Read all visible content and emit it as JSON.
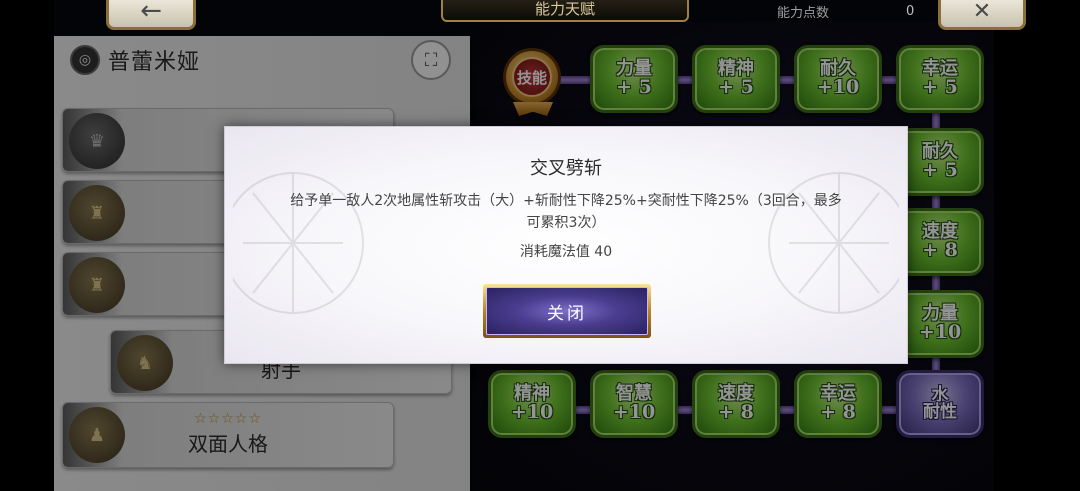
{
  "top_bar": {
    "title": "能力天赋",
    "points_label": "能力点数",
    "points_value": "0",
    "back_icon": "←",
    "close_icon": "✕"
  },
  "character": {
    "name": "普蕾米娅",
    "emblem": "◎",
    "tree_icon": "⛶",
    "cards": [
      {
        "stars": "",
        "label": "",
        "portrait": "♛"
      },
      {
        "stars": "",
        "label": "",
        "portrait": "♜"
      },
      {
        "stars": "",
        "label": "",
        "portrait": "♜"
      },
      {
        "stars": "",
        "label": "射手",
        "portrait": "♞"
      },
      {
        "stars": "☆☆☆☆☆",
        "label": "双面人格",
        "portrait": "♟"
      }
    ]
  },
  "skill_tree": {
    "medal_label": "技能",
    "nodes": [
      {
        "name": "力量",
        "value": "+ 5",
        "kind": "green"
      },
      {
        "name": "精神",
        "value": "+ 5",
        "kind": "green"
      },
      {
        "name": "耐久",
        "value": "+10",
        "kind": "green"
      },
      {
        "name": "幸运",
        "value": "+ 5",
        "kind": "green"
      },
      {
        "name": "耐久",
        "value": "+ 5",
        "kind": "green"
      },
      {
        "name": "速度",
        "value": "+ 8",
        "kind": "green"
      },
      {
        "name": "力量",
        "value": "+10",
        "kind": "green"
      },
      {
        "name": "精神",
        "value": "+10",
        "kind": "green"
      },
      {
        "name": "智慧",
        "value": "+10",
        "kind": "green"
      },
      {
        "name": "速度",
        "value": "+ 8",
        "kind": "green"
      },
      {
        "name": "幸运",
        "value": "+ 8",
        "kind": "green"
      },
      {
        "name": "水",
        "value": "耐性",
        "kind": "purple"
      }
    ]
  },
  "dialog": {
    "title": "交叉劈斩",
    "description_line1": "给予单一敌人2次地属性斩攻击（大）+斩耐性下降25%+突耐性下降25%（3回合，最多",
    "description_line2": "可累积3次）",
    "cost": "消耗魔法值 40",
    "close_button": "关闭"
  }
}
